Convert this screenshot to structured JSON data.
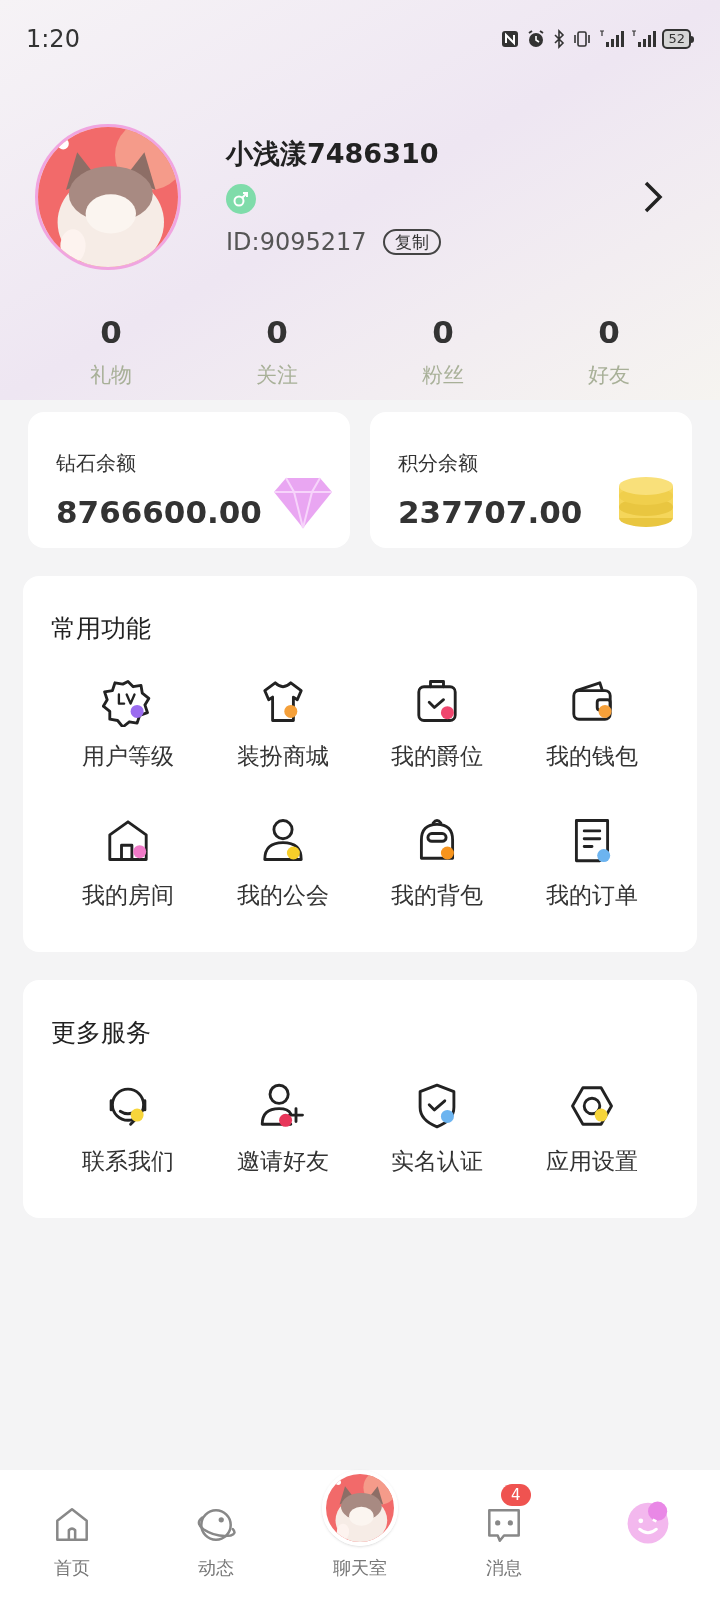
{
  "status_bar": {
    "time": "1:20",
    "battery": "52"
  },
  "profile": {
    "name": "小浅漾7486310",
    "male": true,
    "id": "ID:9095217",
    "copy_button": "复制"
  },
  "stats": [
    {
      "value": "0",
      "label": "礼物"
    },
    {
      "value": "0",
      "label": "关注"
    },
    {
      "value": "0",
      "label": "粉丝"
    },
    {
      "value": "0",
      "label": "好友"
    }
  ],
  "balances": [
    {
      "kind": "diamond",
      "label": "钻石余额",
      "amount": "8766600.00"
    },
    {
      "kind": "coins",
      "label": "积分余额",
      "amount": "237707.00"
    }
  ],
  "sections": [
    {
      "title": "常用功能",
      "items": [
        {
          "kind": "level",
          "label": "用户等级",
          "color": "#9b6cf0"
        },
        {
          "kind": "shirt",
          "label": "装扮商城",
          "color": "#f5a03a"
        },
        {
          "kind": "bag",
          "label": "我的爵位",
          "color": "#f0466e"
        },
        {
          "kind": "wallet",
          "label": "我的钱包",
          "color": "#f5a03a"
        },
        {
          "kind": "house",
          "label": "我的房间",
          "color": "#f07ac8"
        },
        {
          "kind": "person",
          "label": "我的公会",
          "color": "#f7cf2a"
        },
        {
          "kind": "backpack",
          "label": "我的背包",
          "color": "#f7941d"
        },
        {
          "kind": "document",
          "label": "我的订单",
          "color": "#6cb4f0"
        }
      ]
    },
    {
      "title": "更多服务",
      "items": [
        {
          "kind": "headset",
          "label": "联系我们",
          "color": "#f7d53a"
        },
        {
          "kind": "add-user",
          "label": "邀请好友",
          "color": "#e8365a"
        },
        {
          "kind": "shield",
          "label": "实名认证",
          "color": "#6cb4f0"
        },
        {
          "kind": "settings",
          "label": "应用设置",
          "color": "#f7d53a"
        }
      ]
    }
  ],
  "tab_bar": [
    {
      "kind": "home",
      "label": "首页",
      "selected": false
    },
    {
      "kind": "planet",
      "label": "动态",
      "selected": false
    },
    {
      "kind": "chatroom",
      "label": "聊天室",
      "selected": false
    },
    {
      "kind": "messages",
      "label": "消息",
      "selected": false,
      "badge": "4"
    },
    {
      "kind": "me",
      "selected": true
    }
  ]
}
